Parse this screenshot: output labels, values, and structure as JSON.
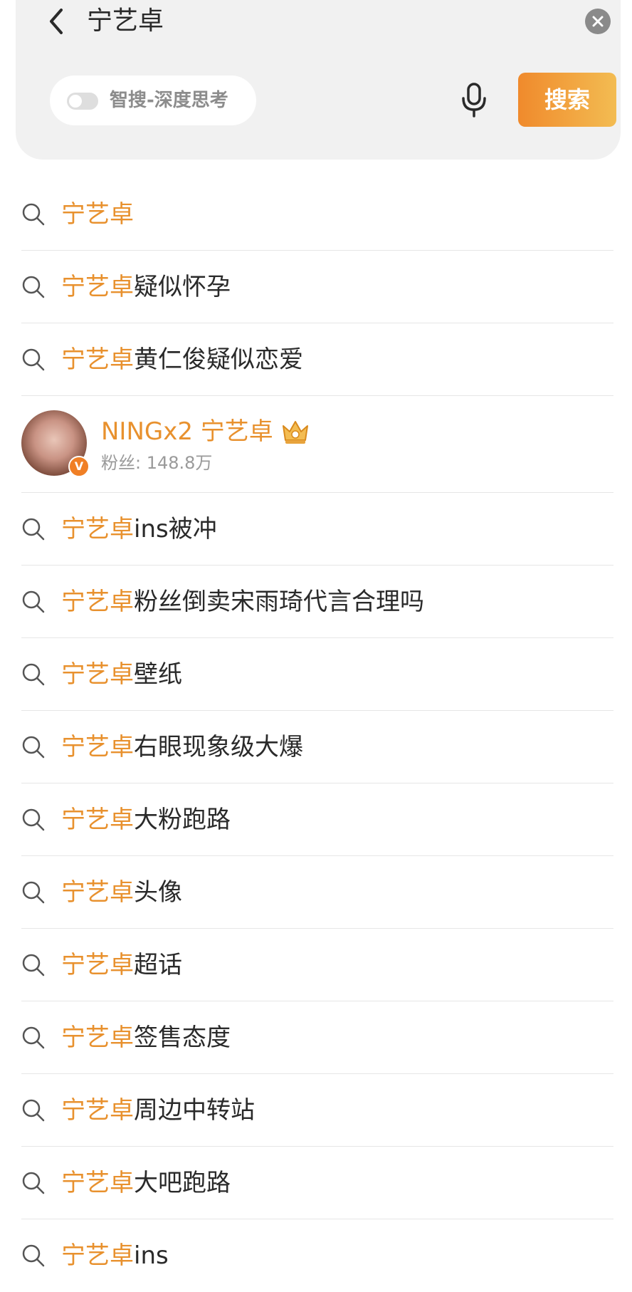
{
  "header": {
    "query": "宁艺卓",
    "mode_label": "智搜-深度思考",
    "search_button": "搜索"
  },
  "suggestions_before": [
    {
      "highlight": "宁艺卓",
      "rest": ""
    },
    {
      "highlight": "宁艺卓",
      "rest": "疑似怀孕"
    },
    {
      "highlight": "宁艺卓",
      "rest": "黄仁俊疑似恋爱"
    }
  ],
  "user": {
    "name": "NINGx2 宁艺卓",
    "fans": "粉丝: 148.8万",
    "verified_mark": "V",
    "badge_color": "#f07f25"
  },
  "suggestions_after": [
    {
      "highlight": "宁艺卓",
      "rest": "ins被冲"
    },
    {
      "highlight": "宁艺卓",
      "rest": "粉丝倒卖宋雨琦代言合理吗"
    },
    {
      "highlight": "宁艺卓",
      "rest": "壁纸"
    },
    {
      "highlight": "宁艺卓",
      "rest": "右眼现象级大爆"
    },
    {
      "highlight": "宁艺卓",
      "rest": "大粉跑路"
    },
    {
      "highlight": "宁艺卓",
      "rest": "头像"
    },
    {
      "highlight": "宁艺卓",
      "rest": "超话"
    },
    {
      "highlight": "宁艺卓",
      "rest": "签售态度"
    },
    {
      "highlight": "宁艺卓",
      "rest": "周边中转站"
    },
    {
      "highlight": "宁艺卓",
      "rest": "大吧跑路"
    },
    {
      "highlight": "宁艺卓",
      "rest": "ins"
    }
  ],
  "colors": {
    "accent": "#e8912e",
    "button_gradient_start": "#f08a2c",
    "button_gradient_end": "#f3bc52"
  },
  "icons": [
    "back-icon",
    "clear-icon",
    "mic-icon",
    "search-icon",
    "crown-icon"
  ]
}
